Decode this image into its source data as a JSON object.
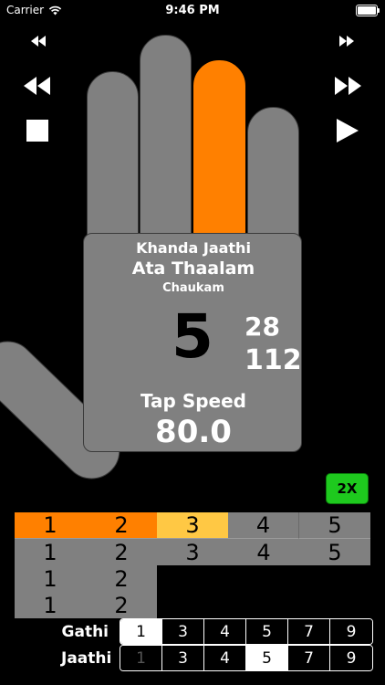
{
  "status_bar": {
    "carrier": "Carrier",
    "time": "9:46 PM"
  },
  "controls": {
    "icons": [
      "skip-back-icon",
      "skip-forward-icon",
      "rewind-icon",
      "fast-forward-icon",
      "stop-icon",
      "play-icon"
    ]
  },
  "hand": {
    "active_finger": "ring",
    "jaathi_name": "Khanda Jaathi",
    "thaalam_name": "Ata Thaalam",
    "nadai_name": "Chaukam",
    "current_beat": "5",
    "count_a": "28",
    "count_b": "112",
    "tap_label": "Tap Speed",
    "tap_value": "80.0",
    "colors": {
      "hand": "#808080",
      "active": "#ff8000"
    }
  },
  "speed_button": {
    "label": "2X",
    "color": "#1ec91e"
  },
  "beat_grid": {
    "rows": [
      [
        "1",
        "2",
        "3",
        "4",
        "5"
      ],
      [
        "1",
        "2",
        "3",
        "4",
        "5"
      ],
      [
        "1",
        "2"
      ],
      [
        "1",
        "2"
      ]
    ],
    "highlight": {
      "color_done": "#ff8000",
      "color_current": "#ffc844"
    }
  },
  "gathi": {
    "label": "Gathi",
    "options": [
      "1",
      "3",
      "4",
      "5",
      "7",
      "9"
    ],
    "selected": "1"
  },
  "jaathi": {
    "label": "Jaathi",
    "options": [
      "1",
      "3",
      "4",
      "5",
      "7",
      "9"
    ],
    "selected": "5"
  }
}
